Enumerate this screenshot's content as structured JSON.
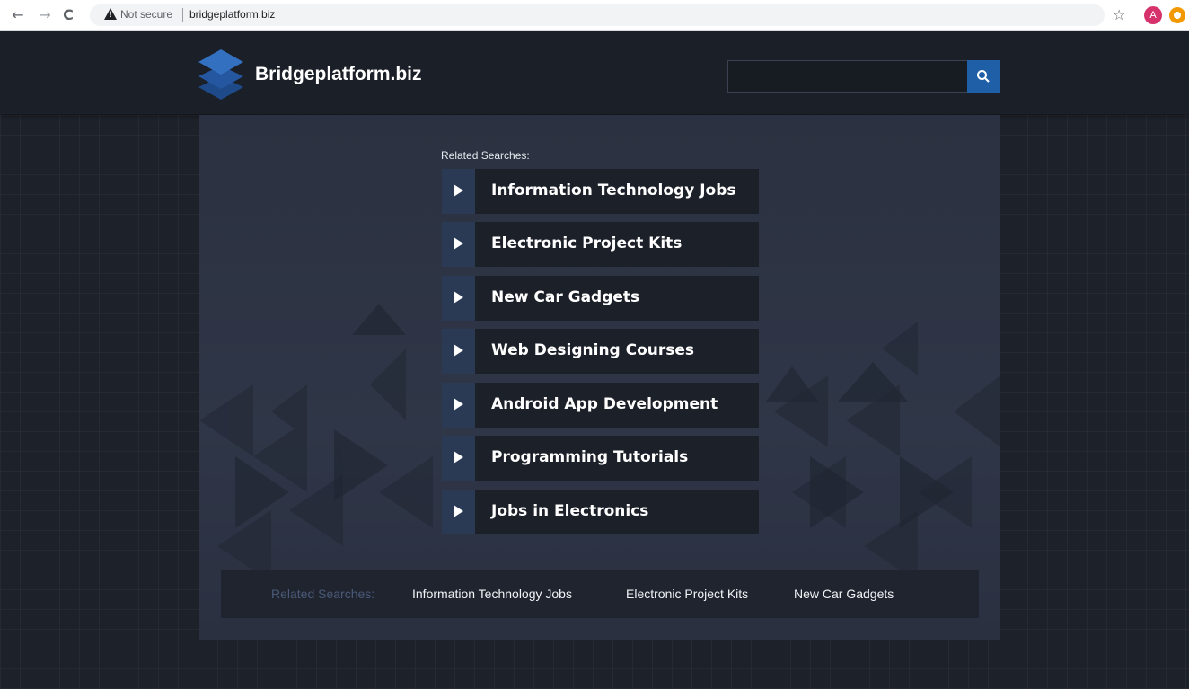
{
  "browser": {
    "back_glyph": "←",
    "forward_glyph": "→",
    "reload_glyph": "C",
    "security_label": "Not secure",
    "url": "bridgeplatform.biz",
    "star_glyph": "☆",
    "profile_initial": "A",
    "icons": [
      "back-arrow-icon",
      "forward-arrow-icon",
      "reload-icon",
      "warning-icon",
      "star-icon",
      "extension-icon"
    ]
  },
  "header": {
    "site_name": "Bridgeplatform.biz",
    "search_placeholder": "",
    "colors": {
      "accent": "#1f5fa8",
      "logo": "#2a5aa0"
    }
  },
  "main": {
    "related_title": "Related Searches:",
    "links": [
      {
        "label": "Information Technology Jobs"
      },
      {
        "label": "Electronic Project Kits"
      },
      {
        "label": "New Car Gadgets"
      },
      {
        "label": "Web Designing Courses"
      },
      {
        "label": "Android App Development"
      },
      {
        "label": "Programming Tutorials"
      },
      {
        "label": "Jobs in Electronics"
      }
    ]
  },
  "footer": {
    "title": "Related Searches:",
    "links": [
      {
        "label": "Information Technology Jobs"
      },
      {
        "label": "Electronic Project Kits"
      },
      {
        "label": "New Car Gadgets"
      }
    ]
  }
}
